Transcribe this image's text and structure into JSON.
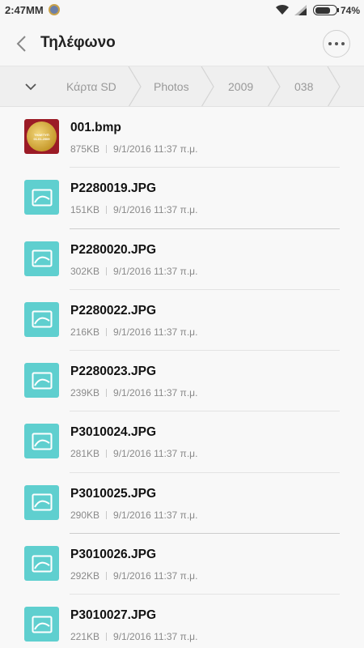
{
  "status_bar": {
    "time": "2:47MM",
    "battery_level": 0.74,
    "battery_percent": "74%"
  },
  "header": {
    "title": "Τηλέφωνο"
  },
  "breadcrumb": {
    "items": [
      "Κάρτα SD",
      "Photos",
      "2009",
      "038"
    ]
  },
  "files": [
    {
      "name": "001.bmp",
      "size": "875KB",
      "date": "9/1/2016 11:37 π.μ.",
      "type": "bmp"
    },
    {
      "name": "P2280019.JPG",
      "size": "151KB",
      "date": "9/1/2016 11:37 π.μ.",
      "type": "image"
    },
    {
      "name": "P2280020.JPG",
      "size": "302KB",
      "date": "9/1/2016 11:37 π.μ.",
      "type": "image"
    },
    {
      "name": "P2280022.JPG",
      "size": "216KB",
      "date": "9/1/2016 11:37 π.μ.",
      "type": "image"
    },
    {
      "name": "P2280023.JPG",
      "size": "239KB",
      "date": "9/1/2016 11:37 π.μ.",
      "type": "image"
    },
    {
      "name": "P3010024.JPG",
      "size": "281KB",
      "date": "9/1/2016 11:37 π.μ.",
      "type": "image"
    },
    {
      "name": "P3010025.JPG",
      "size": "290KB",
      "date": "9/1/2016 11:37 π.μ.",
      "type": "image"
    },
    {
      "name": "P3010026.JPG",
      "size": "292KB",
      "date": "9/1/2016 11:37 π.μ.",
      "type": "image"
    },
    {
      "name": "P3010027.JPG",
      "size": "221KB",
      "date": "9/1/2016 11:37 π.μ.",
      "type": "image"
    }
  ],
  "bmp_thumbnail_text": [
    "ΤΗΛΕΤΥΠ",
    "01.01.2009"
  ],
  "colors": {
    "image_icon_bg": "#5fcfcf",
    "accent_text": "#111111"
  }
}
